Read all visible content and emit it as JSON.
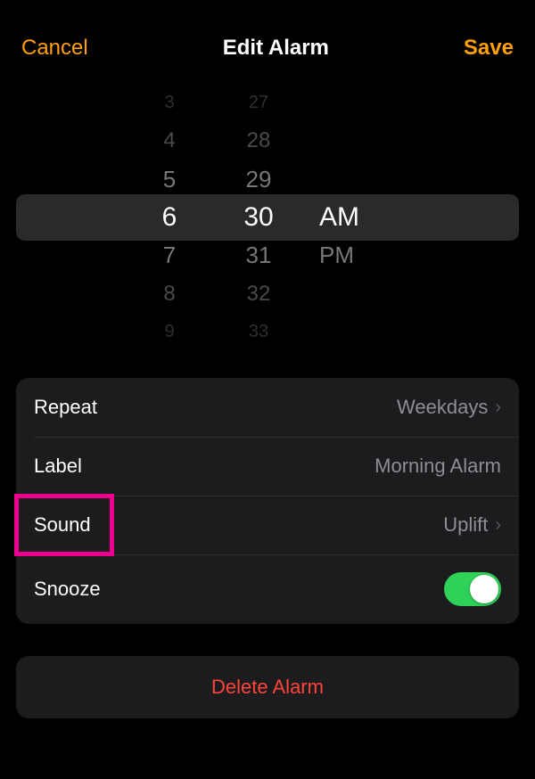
{
  "header": {
    "cancel": "Cancel",
    "title": "Edit Alarm",
    "save": "Save"
  },
  "picker": {
    "hours": [
      "3",
      "4",
      "5",
      "6",
      "7",
      "8",
      "9"
    ],
    "minutes": [
      "27",
      "28",
      "29",
      "30",
      "31",
      "32",
      "33"
    ],
    "ampm": [
      "AM",
      "PM"
    ],
    "selected_hour": "6",
    "selected_minute": "30",
    "selected_ampm": "AM"
  },
  "settings": {
    "repeat": {
      "label": "Repeat",
      "value": "Weekdays"
    },
    "label": {
      "label": "Label",
      "value": "Morning Alarm"
    },
    "sound": {
      "label": "Sound",
      "value": "Uplift"
    },
    "snooze": {
      "label": "Snooze",
      "on": true
    }
  },
  "delete": "Delete Alarm",
  "annotation": {
    "highlight_target": "sound-row"
  }
}
